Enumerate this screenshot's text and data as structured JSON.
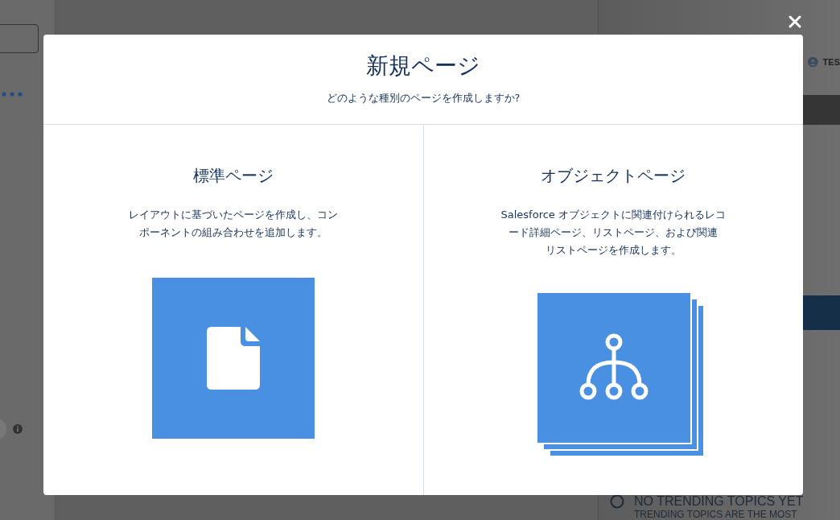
{
  "background": {
    "user_label": "TES",
    "topics_heading": "NO TRENDING TOPICS YET",
    "topics_text": "TRENDING TOPICS ARE THE MOST"
  },
  "modal": {
    "title": "新規ページ",
    "subtitle": "どのような種別のページを作成しますか?",
    "options": [
      {
        "kind": "standard",
        "title": "標準ページ",
        "description_lines": [
          "レイアウトに基づいたページを作成し、コン",
          "ポーネントの組み合わせを追加します。"
        ]
      },
      {
        "kind": "object",
        "title": "オブジェクトページ",
        "description_lines": [
          "Salesforce オブジェクトに関連付けられるレコ",
          "ード詳細ページ、リストページ、および関連",
          "リストページを作成します。"
        ]
      }
    ]
  }
}
